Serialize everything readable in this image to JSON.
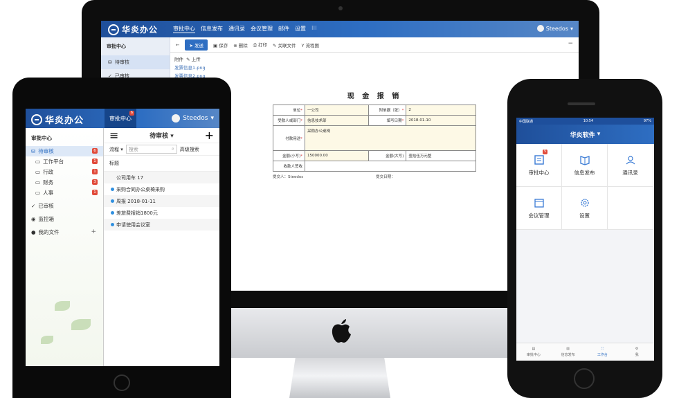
{
  "desktop": {
    "brand": "华炎办公",
    "nav": [
      "审批中心",
      "信息发布",
      "通讯录",
      "会议管理",
      "邮件",
      "设置",
      "⁝⁝⁝"
    ],
    "user": "Steedos",
    "sidebar": {
      "title": "审批中心",
      "items": [
        "待审核",
        "已审核"
      ]
    },
    "toolbar": {
      "back": "←",
      "send": "发送",
      "save": "保存",
      "delete": "删除",
      "print": "打印",
      "related": "关联文件",
      "flowchart": "流程图",
      "collapse": "−"
    },
    "attachments": {
      "label": "附件",
      "upload": "上传",
      "files": [
        "发票信息1.png",
        "发票信息2.png"
      ]
    },
    "form": {
      "title": "现 金 报 销",
      "unit_label": "单位",
      "unit_value": "一公司",
      "attach_count_label": "附单据（张）",
      "attach_count_value": "2",
      "dept_label": "受款人或部门",
      "dept_value": "信息技术部",
      "date_label": "填写日期",
      "date_value": "2018-01-10",
      "purpose_label": "付款用途",
      "purpose_value": "采购办公桌椅",
      "amount_small_label": "金额(小写)",
      "amount_small_value": "150000.00",
      "amount_big_label": "金额(大写)",
      "amount_big_value": "壹拾伍万元整",
      "receiver_label": "收款人签收",
      "submitter": "提交人：Steedos",
      "submit_date": "提交日期："
    }
  },
  "tablet": {
    "brand": "华炎办公",
    "tab": "审批中心",
    "tab_badge": "6",
    "user": "Steedos",
    "sidebar_title": "审批中心",
    "pending": {
      "label": "待审核",
      "count": "6"
    },
    "categories": [
      {
        "label": "工作平台",
        "count": "1"
      },
      {
        "label": "行政",
        "count": "1"
      },
      {
        "label": "财务",
        "count": "3"
      },
      {
        "label": "人事",
        "count": "1"
      }
    ],
    "approved": "已审核",
    "monitor": "监控箱",
    "my_files": "我的文件",
    "list_title": "待审核",
    "flow_label": "流程",
    "search_placeholder": "搜索",
    "advanced_search": "高级搜索",
    "column_header": "标题",
    "items": [
      "公司用车 17",
      "采购合同办公桌椅采购",
      "周报 2018-01-11",
      "差旅费报销1800元",
      "申请使用会议室"
    ]
  },
  "phone": {
    "carrier": "中国联通",
    "time": "10:54",
    "battery": "97%",
    "title": "华炎软件",
    "apps": [
      {
        "label": "审批中心",
        "badge": "5"
      },
      {
        "label": "信息发布"
      },
      {
        "label": "通讯录"
      },
      {
        "label": "会议管理"
      },
      {
        "label": "设置"
      }
    ],
    "tabs": [
      "审批中心",
      "信息发布",
      "工作台",
      "我"
    ]
  },
  "colors": {
    "brand_blue": "#2e6ec2",
    "badge_red": "#e14b3b"
  }
}
